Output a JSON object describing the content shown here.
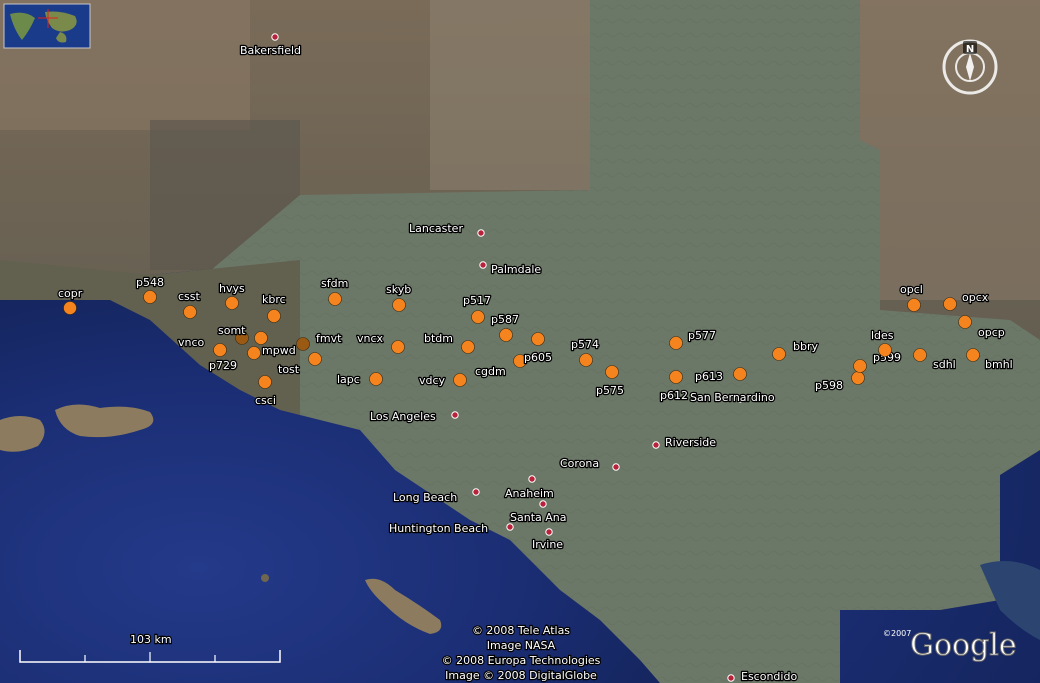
{
  "map": {
    "stations": [
      {
        "name": "copr",
        "type": "orange"
      },
      {
        "name": "p548",
        "type": "orange"
      },
      {
        "name": "csst",
        "type": "orange"
      },
      {
        "name": "hvys",
        "type": "orange"
      },
      {
        "name": "kbrc",
        "type": "orange"
      },
      {
        "name": "sfdm",
        "type": "orange"
      },
      {
        "name": "skyb",
        "type": "orange"
      },
      {
        "name": "p517",
        "type": "orange"
      },
      {
        "name": "p587",
        "type": "orange"
      },
      {
        "name": "vnco",
        "type": "orange"
      },
      {
        "name": "somt",
        "type": "dark"
      },
      {
        "name": "fmvt",
        "type": "dark"
      },
      {
        "name": "mpwd",
        "type": "orange"
      },
      {
        "name": "vncx",
        "type": "orange"
      },
      {
        "name": "btdm",
        "type": "orange"
      },
      {
        "name": "p605",
        "type": "orange"
      },
      {
        "name": "p574",
        "type": "orange"
      },
      {
        "name": "p577",
        "type": "orange"
      },
      {
        "name": "p729",
        "type": "orange"
      },
      {
        "name": "tost",
        "type": "orange"
      },
      {
        "name": "csci",
        "type": "orange"
      },
      {
        "name": "lapc",
        "type": "orange"
      },
      {
        "name": "vdcy",
        "type": "orange"
      },
      {
        "name": "cgdm",
        "type": "orange"
      },
      {
        "name": "p575",
        "type": "orange"
      },
      {
        "name": "p612",
        "type": "orange"
      },
      {
        "name": "p613",
        "type": "orange"
      },
      {
        "name": "bbry",
        "type": "orange"
      },
      {
        "name": "p598",
        "type": "orange"
      },
      {
        "name": "p599",
        "type": "orange"
      },
      {
        "name": "ldes",
        "type": "orange"
      },
      {
        "name": "sdhl",
        "type": "orange"
      },
      {
        "name": "bmhl",
        "type": "orange"
      },
      {
        "name": "opcl",
        "type": "orange"
      },
      {
        "name": "opcx",
        "type": "orange"
      },
      {
        "name": "opcp",
        "type": "orange"
      }
    ],
    "cities": [
      "Bakersfield",
      "Lancaster",
      "Palmdale",
      "Los Angeles",
      "Riverside",
      "Corona",
      "Long Beach",
      "Anaheim",
      "Santa Ana",
      "Huntington Beach",
      "Irvine",
      "San Bernardino",
      "Escondido"
    ],
    "credits": [
      "© 2008 Tele Atlas",
      "Image NASA",
      "© 2008 Europa Technologies",
      "Image © 2008 DigitalGlobe"
    ],
    "logo": "Google",
    "logo_copyright": "©2007",
    "scale_label": "103 km",
    "compass_letter": "N",
    "colors": {
      "station": "#f5841f",
      "station_dark": "#9a5a14",
      "city_dot": "#b8223a",
      "ocean": "#1c3079",
      "land": "#6d7a6a"
    }
  }
}
